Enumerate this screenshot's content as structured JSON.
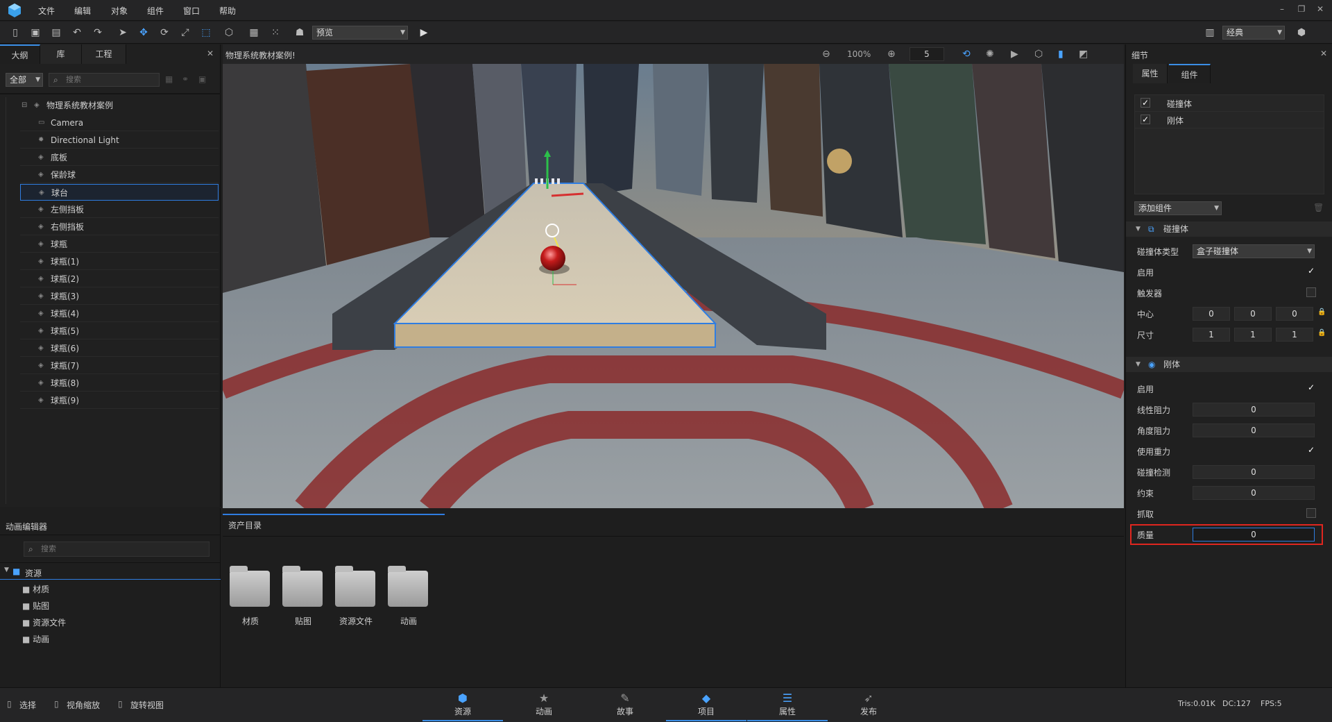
{
  "menu": [
    "文件",
    "编辑",
    "对象",
    "组件",
    "窗口",
    "帮助"
  ],
  "toolbar": {
    "preview_label": "预览",
    "layout_label": "经典"
  },
  "outline": {
    "tabs": [
      "大纲",
      "库",
      "工程"
    ],
    "filter": "全部",
    "search_placeholder": "搜索",
    "root": "物理系统教材案例",
    "items": [
      "Camera",
      "Directional Light",
      "底板",
      "保龄球",
      "球台",
      "左侧挡板",
      "右侧挡板",
      "球瓶",
      "球瓶(1)",
      "球瓶(2)",
      "球瓶(3)",
      "球瓶(4)",
      "球瓶(5)",
      "球瓶(6)",
      "球瓶(7)",
      "球瓶(8)",
      "球瓶(9)"
    ],
    "selected_index": 4
  },
  "viewport": {
    "title": "物理系统教材案例!",
    "zoom": "100%",
    "grid_value": "5"
  },
  "details": {
    "title": "细节",
    "tabs": [
      "属性",
      "组件"
    ],
    "components": [
      "碰撞体",
      "刚体"
    ],
    "add_component": "添加组件",
    "collider": {
      "section": "碰撞体",
      "type_label": "碰撞体类型",
      "type_value": "盒子碰撞体",
      "enable_label": "启用",
      "trigger_label": "触发器",
      "center_label": "中心",
      "center": [
        "0",
        "0",
        "0"
      ],
      "size_label": "尺寸",
      "size": [
        "1",
        "1",
        "1"
      ]
    },
    "rigidbody": {
      "section": "刚体",
      "enable_label": "启用",
      "linear_drag_label": "线性阻力",
      "linear_drag": "0",
      "angular_drag_label": "角度阻力",
      "angular_drag": "0",
      "gravity_label": "使用重力",
      "collision_label": "碰撞检测",
      "collision": "0",
      "constraint_label": "约束",
      "constraint": "0",
      "grab_label": "抓取",
      "mass_label": "质量",
      "mass": "0"
    }
  },
  "anim_editor": {
    "title": "动画编辑器",
    "search_placeholder": "搜索",
    "root": "资源",
    "folders": [
      "材质",
      "贴图",
      "资源文件",
      "动画"
    ]
  },
  "assets": {
    "title": "资产目录",
    "folders": [
      "材质",
      "贴图",
      "资源文件",
      "动画"
    ]
  },
  "statusbar": {
    "hints": [
      "选择",
      "视角缩放",
      "旋转视图"
    ],
    "tabs": [
      "资源",
      "动画",
      "故事",
      "项目",
      "属性",
      "发布"
    ],
    "stats": [
      "Tris:0.01K",
      "DC:127",
      "FPS:5"
    ]
  },
  "colors": {
    "accent": "#2f7de1",
    "highlight": "#e0261f",
    "panel": "#202020"
  }
}
